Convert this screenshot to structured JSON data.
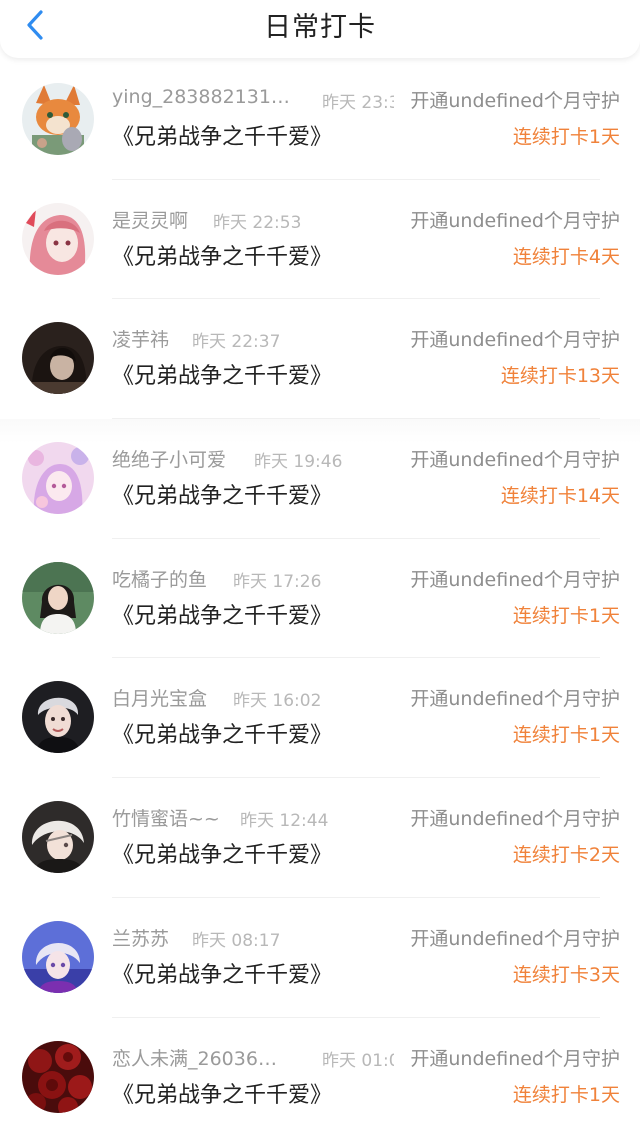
{
  "header": {
    "title": "日常打卡"
  },
  "colors": {
    "accent": "#f0823a",
    "back_icon": "#2f8cf0",
    "name_text": "#9a9a9a",
    "time_text": "#b8b8b8"
  },
  "entries": [
    {
      "name": "ying_283882131…",
      "time": "昨天 23:3",
      "status": "开通undefined个月守护",
      "book": "《兄弟战争之千千爱》",
      "streak": "连续打卡1天",
      "avatar_icon": "cartoon-avatar-icon"
    },
    {
      "name": "是灵灵啊",
      "time": "昨天 22:53",
      "status": "开通undefined个月守护",
      "book": "《兄弟战争之千千爱》",
      "streak": "连续打卡4天",
      "avatar_icon": "anime-girl-avatar-icon"
    },
    {
      "name": "凌芋祎",
      "time": "昨天 22:37",
      "status": "开通undefined个月守护",
      "book": "《兄弟战争之千千爱》",
      "streak": "连续打卡13天",
      "avatar_icon": "dark-photo-avatar-icon"
    },
    {
      "name": "绝绝子小可爱",
      "time": "昨天 19:46",
      "status": "开通undefined个月守护",
      "book": "《兄弟战争之千千爱》",
      "streak": "连续打卡14天",
      "avatar_icon": "pink-anime-avatar-icon"
    },
    {
      "name": "吃橘子的鱼",
      "time": "昨天 17:26",
      "status": "开通undefined个月守护",
      "book": "《兄弟战争之千千爱》",
      "streak": "连续打卡1天",
      "avatar_icon": "girl-photo-avatar-icon"
    },
    {
      "name": "白月光宝盒",
      "time": "昨天 16:02",
      "status": "开通undefined个月守护",
      "book": "《兄弟战争之千千爱》",
      "streak": "连续打卡1天",
      "avatar_icon": "boy-photo-avatar-icon"
    },
    {
      "name": "竹情蜜语~~",
      "time": "昨天 12:44",
      "status": "开通undefined个月守护",
      "book": "《兄弟战争之千千爱》",
      "streak": "连续打卡2天",
      "avatar_icon": "anime-boy-avatar-icon"
    },
    {
      "name": "兰苏苏",
      "time": "昨天 08:17",
      "status": "开通undefined个月守护",
      "book": "《兄弟战争之千千爱》",
      "streak": "连续打卡3天",
      "avatar_icon": "blue-anime-avatar-icon"
    },
    {
      "name": "恋人未满_26036…",
      "time": "昨天 01:0",
      "status": "开通undefined个月守护",
      "book": "《兄弟战争之千千爱》",
      "streak": "连续打卡1天",
      "avatar_icon": "roses-avatar-icon"
    }
  ]
}
